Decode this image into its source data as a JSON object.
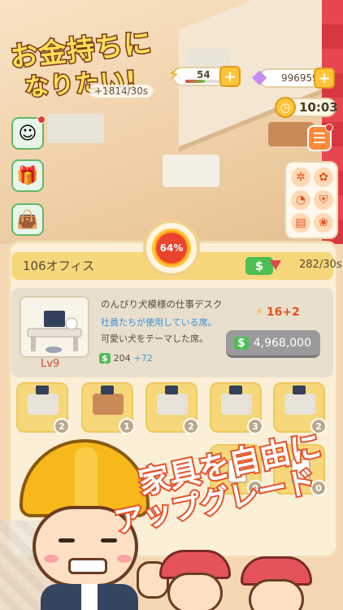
{
  "title": {
    "line1": "お金持ちに",
    "line2": "なりたい!"
  },
  "hud": {
    "income": "+1814/30s",
    "energy_value": "54",
    "energy_fill": 0.55,
    "gems_value": "996959",
    "clock_value": "10:03",
    "plus_label": "+"
  },
  "progress": {
    "percent_label": "64%"
  },
  "office": {
    "name": "106オフィス",
    "cash_symbol": "$",
    "rate": "282/30s"
  },
  "item": {
    "name": "のんびり犬模様の仕事デスク",
    "desc_line1": "社員たちが使用している席。",
    "desc_line2": "可愛い犬をテーマした席。",
    "level": "Lv9",
    "income_symbol": "$",
    "income_base": "204",
    "income_bonus": "+72",
    "power_base": "16",
    "power_bonus": "+2",
    "price_symbol": "$",
    "price": "4,968,000"
  },
  "grid_items": [
    {
      "badge": "2",
      "style": "white"
    },
    {
      "badge": "1",
      "style": "wood"
    },
    {
      "badge": "2",
      "style": "white"
    },
    {
      "badge": "3",
      "style": "white"
    },
    {
      "badge": "2",
      "style": "white"
    }
  ],
  "drawer_items": [
    {
      "badge": "0"
    },
    {
      "badge": "0"
    }
  ],
  "promo": {
    "line1": "家具を自由に",
    "line2": "アップグレード",
    "line1_part_a": "家具を自由に"
  },
  "colors": {
    "accent": "#f6d77a",
    "cash_green": "#4cbe54",
    "alert_red": "#e43a32",
    "promo_stroke": "#e6532a"
  }
}
